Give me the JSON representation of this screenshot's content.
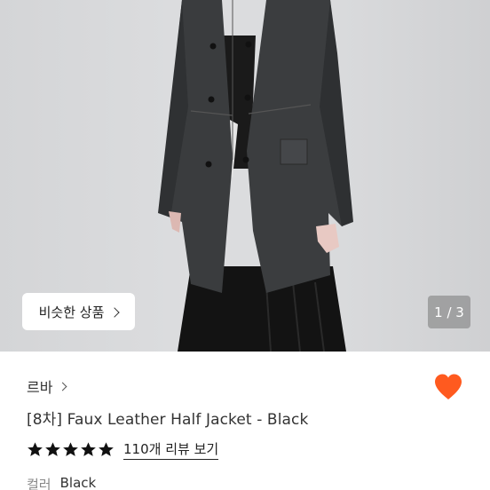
{
  "gallery": {
    "similar_button_label": "비슷한 상품",
    "page_indicator": "1 / 3"
  },
  "product": {
    "shop_name": "르바",
    "title": "[8차] Faux Leather Half Jacket - Black",
    "rating_stars": 5,
    "review_link": "110개 리뷰 보기",
    "option_label": "컬러",
    "option_value": "Black"
  },
  "colors": {
    "heart": "#ff5a1f",
    "star": "#111111"
  },
  "icons": [
    "chevron-right-icon",
    "heart-icon",
    "star-icon"
  ]
}
